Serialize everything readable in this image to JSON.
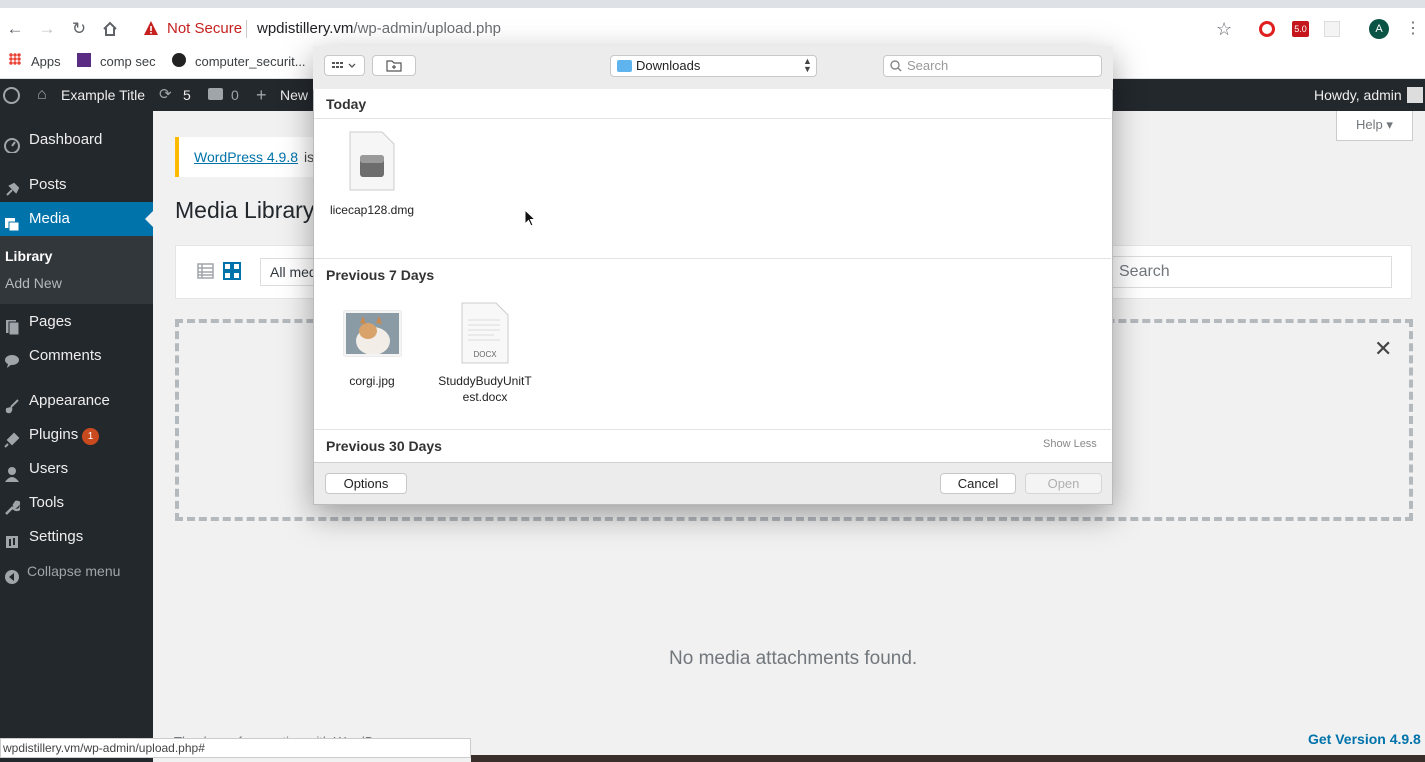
{
  "browser": {
    "security_label": "Not Secure",
    "url_host": "wpdistillery.vm",
    "url_path": "/wp-admin/upload.php",
    "bookmarks": [
      "Apps",
      "comp sec",
      "computer_securit..."
    ],
    "extension_badge": "5.0",
    "profile_initial": "A",
    "status_url": "wpdistillery.vm/wp-admin/upload.php#"
  },
  "adminbar": {
    "site_title": "Example Title",
    "updates_count": "5",
    "comments_count": "0",
    "new_label": "New",
    "howdy": "Howdy, admin"
  },
  "sidebar": {
    "items": [
      {
        "label": "Dashboard",
        "icon": "dashboard-icon"
      },
      {
        "label": "Posts",
        "icon": "pin-icon"
      },
      {
        "label": "Media",
        "icon": "media-icon"
      },
      {
        "label": "Pages",
        "icon": "pages-icon"
      },
      {
        "label": "Comments",
        "icon": "comment-icon"
      },
      {
        "label": "Appearance",
        "icon": "brush-icon"
      },
      {
        "label": "Plugins",
        "icon": "plug-icon"
      },
      {
        "label": "Users",
        "icon": "user-icon"
      },
      {
        "label": "Tools",
        "icon": "wrench-icon"
      },
      {
        "label": "Settings",
        "icon": "settings-icon"
      }
    ],
    "submenu": [
      "Library",
      "Add New"
    ],
    "plugins_badge": "1",
    "collapse": "Collapse menu"
  },
  "main": {
    "notice_link": "WordPress 4.9.8",
    "notice_tail": "is",
    "page_title": "Media Library",
    "filter_select": "All med",
    "search_placeholder": "Search",
    "help": "Help",
    "no_media": "No media attachments found.",
    "footer_thanks": "Thank you for creating with WordPress.",
    "get_version": "Get Version 4.9.8"
  },
  "dialog": {
    "location": "Downloads",
    "search_placeholder": "Search",
    "sections": {
      "today": "Today",
      "week": "Previous 7 Days",
      "month": "Previous 30 Days"
    },
    "files_today": [
      "licecap128.dmg"
    ],
    "files_week": [
      "corgi.jpg",
      "StuddyBudyUnitT",
      "est.docx"
    ],
    "docx_tag": "DOCX",
    "show_less": "Show Less",
    "options": "Options",
    "cancel": "Cancel",
    "open": "Open"
  }
}
